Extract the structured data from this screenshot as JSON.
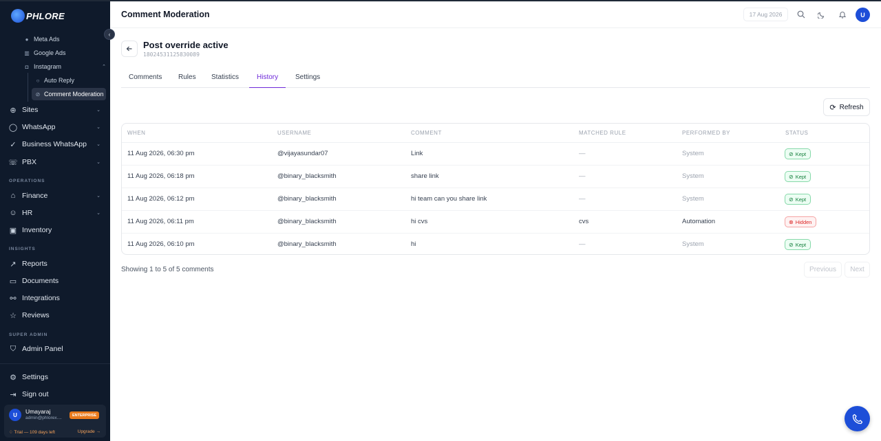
{
  "brand": {
    "name": "PHLORE"
  },
  "sidebar": {
    "sub_items": [
      {
        "label": "Meta Ads",
        "icon": "meta-icon"
      },
      {
        "label": "Google Ads",
        "icon": "chart-icon"
      },
      {
        "label": "Instagram",
        "icon": "instagram-icon"
      }
    ],
    "instagram_children": [
      {
        "label": "Auto Reply",
        "icon": "chat-icon"
      },
      {
        "label": "Comment Moderation",
        "icon": "moderation-icon",
        "active": true
      }
    ],
    "nav_group_1": [
      "Sites",
      "WhatsApp",
      "Business WhatsApp",
      "PBX"
    ],
    "section_operations": "OPERATIONS",
    "nav_group_2": [
      "Finance",
      "HR",
      "Inventory"
    ],
    "section_insights": "INSIGHTS",
    "nav_group_3": [
      "Reports",
      "Documents",
      "Integrations",
      "Reviews"
    ],
    "section_super_admin": "SUPER ADMIN",
    "nav_group_4": [
      "Admin Panel"
    ],
    "bottom": [
      "Settings",
      "Sign out"
    ],
    "user": {
      "initial": "U",
      "name": "Umayaraj",
      "email": "admin@phlorex....",
      "plan": "ENTERPRISE",
      "trial": "♢ Trial — 109 days left",
      "upgrade": "Upgrade →"
    }
  },
  "topbar": {
    "title": "Comment Moderation",
    "date": "17 Aug 2026",
    "avatar": "U"
  },
  "post": {
    "title": "Post override active",
    "id": "18024531125830089"
  },
  "tabs": [
    "Comments",
    "Rules",
    "Statistics",
    "History",
    "Settings"
  ],
  "active_tab": "History",
  "refresh_label": "Refresh",
  "table": {
    "columns": [
      "WHEN",
      "USERNAME",
      "COMMENT",
      "MATCHED RULE",
      "PERFORMED BY",
      "STATUS"
    ],
    "rows": [
      {
        "when": "11 Aug 2026, 06:30 pm",
        "username": "@vijayasundar07",
        "comment": "Link",
        "rule": "—",
        "by": "System",
        "status": "Kept"
      },
      {
        "when": "11 Aug 2026, 06:18 pm",
        "username": "@binary_blacksmith",
        "comment": "share link",
        "rule": "—",
        "by": "System",
        "status": "Kept"
      },
      {
        "when": "11 Aug 2026, 06:12 pm",
        "username": "@binary_blacksmith",
        "comment": "hi team can you share link",
        "rule": "—",
        "by": "System",
        "status": "Kept"
      },
      {
        "when": "11 Aug 2026, 06:11 pm",
        "username": "@binary_blacksmith",
        "comment": "hi cvs",
        "rule": "cvs",
        "by": "Automation",
        "status": "Hidden"
      },
      {
        "when": "11 Aug 2026, 06:10 pm",
        "username": "@binary_blacksmith",
        "comment": "hi",
        "rule": "—",
        "by": "System",
        "status": "Kept"
      }
    ]
  },
  "pagination": {
    "summary": "Showing 1 to 5 of 5 comments",
    "previous": "Previous",
    "next": "Next"
  },
  "colors": {
    "sidebar_bg": "#0f1a2b",
    "accent": "#6d28d9",
    "primary": "#1d4ed8",
    "kept": "#15803d",
    "hidden": "#dc2626",
    "enterprise": "#ea7a1c"
  }
}
